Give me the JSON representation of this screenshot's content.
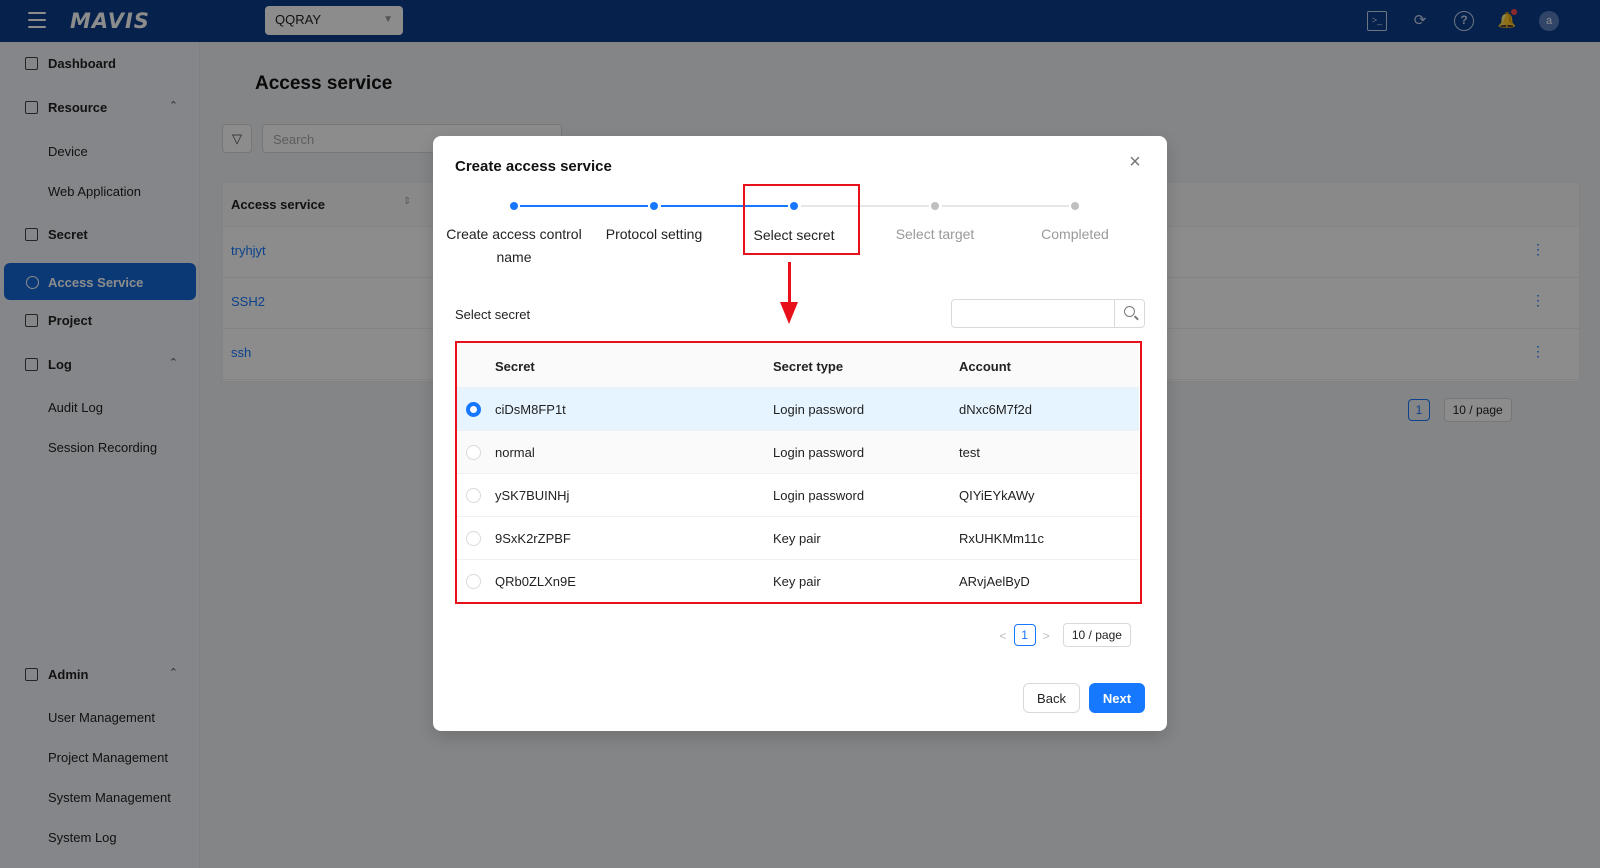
{
  "header": {
    "logo": "MAVIS",
    "project": "QQRAY",
    "avatar_letter": "a"
  },
  "sidebar": {
    "dashboard": "Dashboard",
    "resource": "Resource",
    "device": "Device",
    "web_application": "Web Application",
    "secret": "Secret",
    "access_service": "Access Service",
    "project": "Project",
    "log": "Log",
    "audit_log": "Audit Log",
    "session_recording": "Session Recording",
    "admin": "Admin",
    "user_management": "User Management",
    "project_management": "Project Management",
    "system_management": "System Management",
    "system_log": "System Log"
  },
  "page": {
    "title": "Access service",
    "search_placeholder": "Search",
    "column_access_service": "Access service",
    "rows": [
      "tryhjyt",
      "SSH2",
      "ssh"
    ],
    "current_page": "1",
    "page_size": "10 / page"
  },
  "modal": {
    "title": "Create access service",
    "steps": [
      {
        "label": "Create access control name",
        "status": "done"
      },
      {
        "label": "Protocol setting",
        "status": "done"
      },
      {
        "label": "Select secret",
        "status": "current"
      },
      {
        "label": "Select target",
        "status": "todo"
      },
      {
        "label": "Completed",
        "status": "todo"
      }
    ],
    "select_label": "Select secret",
    "search_value": "",
    "columns": {
      "secret": "Secret",
      "type": "Secret type",
      "account": "Account"
    },
    "secrets": [
      {
        "secret": "ciDsM8FP1t",
        "type": "Login password",
        "account": "dNxc6M7f2d",
        "selected": true
      },
      {
        "secret": "normal",
        "type": "Login password",
        "account": "test",
        "selected": false
      },
      {
        "secret": "ySK7BUINHj",
        "type": "Login password",
        "account": "QIYiEYkAWy",
        "selected": false
      },
      {
        "secret": "9SxK2rZPBF",
        "type": "Key pair",
        "account": "RxUHKMm11c",
        "selected": false
      },
      {
        "secret": "QRb0ZLXn9E",
        "type": "Key pair",
        "account": "ARvjAelByD",
        "selected": false
      }
    ],
    "current_page": "1",
    "page_size": "10 / page",
    "back_label": "Back",
    "next_label": "Next"
  },
  "colors": {
    "topbar": "#0c3f8a",
    "accent": "#1677ff",
    "annotation": "#e8101a"
  }
}
